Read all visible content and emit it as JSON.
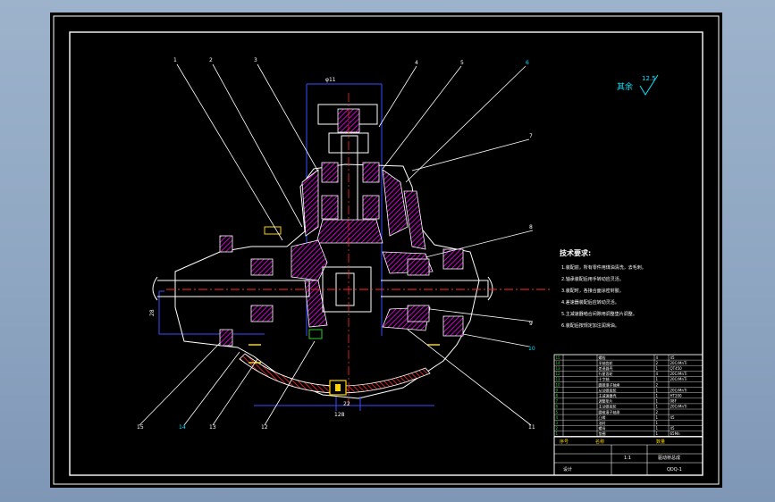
{
  "drawing": {
    "roughness_text": "其余",
    "roughness_value": "12.5",
    "tech_title": "技术要求:",
    "tech_lines": [
      "1.装配前，所有零件用煤油清洗，去毛刺。",
      "2.轴承装配后用手转动应灵活。",
      "3.装配时，各接合面涂密封胶。",
      "4.差速器装配后应转动灵活。",
      "5.主减速器啮合间隙用调整垫片调整。",
      "6.装配后按规定加注润滑油。"
    ],
    "part_callouts": [
      "1",
      "2",
      "3",
      "4",
      "5",
      "6",
      "7",
      "8",
      "9",
      "10",
      "11",
      "12",
      "13",
      "14",
      "15"
    ],
    "dim_top": "φ11",
    "dim_bottom": "128",
    "dim_center": "22",
    "dim_left": "28",
    "bom_rows": [
      [
        "15",
        "",
        "螺栓",
        "4",
        "45"
      ],
      [
        "14",
        "",
        "半轴齿轮",
        "2",
        "20CrMnTi"
      ],
      [
        "13",
        "",
        "差速器壳",
        "1",
        "QT450"
      ],
      [
        "12",
        "",
        "行星齿轮",
        "4",
        "20CrMnTi"
      ],
      [
        "11",
        "",
        "十字轴",
        "1",
        "20CrMnTi"
      ],
      [
        "10",
        "",
        "圆锥滚子轴承",
        "2",
        ""
      ],
      [
        "9",
        "",
        "从动锥齿轮",
        "1",
        "20CrMnTi"
      ],
      [
        "8",
        "",
        "主减速器壳",
        "1",
        "HT200"
      ],
      [
        "7",
        "",
        "调整垫片",
        "1",
        "08F"
      ],
      [
        "6",
        "",
        "主动锥齿轮",
        "1",
        "20CrMnTi"
      ],
      [
        "5",
        "",
        "圆锥滚子轴承",
        "2",
        ""
      ],
      [
        "4",
        "",
        "凸缘",
        "1",
        "45"
      ],
      [
        "3",
        "",
        "油封",
        "1",
        ""
      ],
      [
        "2",
        "",
        "螺母",
        "1",
        "45"
      ],
      [
        "1",
        "",
        "垫圈",
        "1",
        "65Mn"
      ]
    ],
    "title_block": {
      "header_no": "序号",
      "header_name": "名称",
      "header_qty": "数量",
      "scale": "1:1",
      "drawing_title": "驱动桥总成",
      "drawing_no": "QDQ-1",
      "designer": "设计"
    }
  }
}
